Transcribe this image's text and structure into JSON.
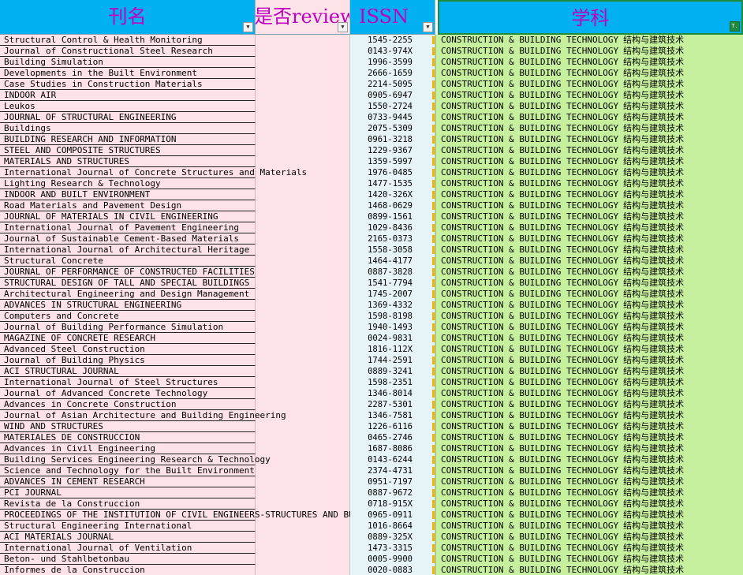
{
  "headers": {
    "journal": "刊名",
    "review": "是否review",
    "issn": "ISSN",
    "subject": "学科",
    "filter_arrow": "▼",
    "filter_active": "T."
  },
  "rows": [
    {
      "title": "Structural Control & Health Monitoring",
      "issn": "1545-2255",
      "subject_en": "CONSTRUCTION & BUILDING TECHNOLOGY",
      "subject_cn": "结构与建筑技术"
    },
    {
      "title": "Journal of Constructional Steel Research",
      "issn": "0143-974X",
      "subject_en": "CONSTRUCTION & BUILDING TECHNOLOGY",
      "subject_cn": "结构与建筑技术"
    },
    {
      "title": "Building Simulation",
      "issn": "1996-3599",
      "subject_en": "CONSTRUCTION & BUILDING TECHNOLOGY",
      "subject_cn": "结构与建筑技术"
    },
    {
      "title": "Developments in the Built Environment",
      "issn": "2666-1659",
      "subject_en": "CONSTRUCTION & BUILDING TECHNOLOGY",
      "subject_cn": "结构与建筑技术"
    },
    {
      "title": "Case Studies in Construction Materials",
      "issn": "2214-5095",
      "subject_en": "CONSTRUCTION & BUILDING TECHNOLOGY",
      "subject_cn": "结构与建筑技术"
    },
    {
      "title": "INDOOR AIR",
      "issn": "0905-6947",
      "subject_en": "CONSTRUCTION & BUILDING TECHNOLOGY",
      "subject_cn": "结构与建筑技术"
    },
    {
      "title": "Leukos",
      "issn": "1550-2724",
      "subject_en": "CONSTRUCTION & BUILDING TECHNOLOGY",
      "subject_cn": "结构与建筑技术"
    },
    {
      "title": "JOURNAL OF STRUCTURAL ENGINEERING",
      "issn": "0733-9445",
      "subject_en": "CONSTRUCTION & BUILDING TECHNOLOGY",
      "subject_cn": "结构与建筑技术"
    },
    {
      "title": "Buildings",
      "issn": "2075-5309",
      "subject_en": "CONSTRUCTION & BUILDING TECHNOLOGY",
      "subject_cn": "结构与建筑技术"
    },
    {
      "title": "BUILDING RESEARCH AND INFORMATION",
      "issn": "0961-3218",
      "subject_en": "CONSTRUCTION & BUILDING TECHNOLOGY",
      "subject_cn": "结构与建筑技术"
    },
    {
      "title": "STEEL AND COMPOSITE STRUCTURES",
      "issn": "1229-9367",
      "subject_en": "CONSTRUCTION & BUILDING TECHNOLOGY",
      "subject_cn": "结构与建筑技术"
    },
    {
      "title": "MATERIALS AND STRUCTURES",
      "issn": "1359-5997",
      "subject_en": "CONSTRUCTION & BUILDING TECHNOLOGY",
      "subject_cn": "结构与建筑技术"
    },
    {
      "title": "International Journal of Concrete Structures and Materials",
      "issn": "1976-0485",
      "subject_en": "CONSTRUCTION & BUILDING TECHNOLOGY",
      "subject_cn": "结构与建筑技术"
    },
    {
      "title": "Lighting Research & Technology",
      "issn": "1477-1535",
      "subject_en": "CONSTRUCTION & BUILDING TECHNOLOGY",
      "subject_cn": "结构与建筑技术"
    },
    {
      "title": "INDOOR AND BUILT ENVIRONMENT",
      "issn": "1420-326X",
      "subject_en": "CONSTRUCTION & BUILDING TECHNOLOGY",
      "subject_cn": "结构与建筑技术"
    },
    {
      "title": "Road Materials and Pavement Design",
      "issn": "1468-0629",
      "subject_en": "CONSTRUCTION & BUILDING TECHNOLOGY",
      "subject_cn": "结构与建筑技术"
    },
    {
      "title": "JOURNAL OF MATERIALS IN CIVIL ENGINEERING",
      "issn": "0899-1561",
      "subject_en": "CONSTRUCTION & BUILDING TECHNOLOGY",
      "subject_cn": "结构与建筑技术"
    },
    {
      "title": "International Journal of Pavement Engineering",
      "issn": "1029-8436",
      "subject_en": "CONSTRUCTION & BUILDING TECHNOLOGY",
      "subject_cn": "结构与建筑技术"
    },
    {
      "title": "Journal of Sustainable Cement-Based Materials",
      "issn": "2165-0373",
      "subject_en": "CONSTRUCTION & BUILDING TECHNOLOGY",
      "subject_cn": "结构与建筑技术"
    },
    {
      "title": "International Journal of Architectural Heritage",
      "issn": "1558-3058",
      "subject_en": "CONSTRUCTION & BUILDING TECHNOLOGY",
      "subject_cn": "结构与建筑技术"
    },
    {
      "title": "Structural Concrete",
      "issn": "1464-4177",
      "subject_en": "CONSTRUCTION & BUILDING TECHNOLOGY",
      "subject_cn": "结构与建筑技术"
    },
    {
      "title": "JOURNAL OF PERFORMANCE OF CONSTRUCTED FACILITIES",
      "issn": "0887-3828",
      "subject_en": "CONSTRUCTION & BUILDING TECHNOLOGY",
      "subject_cn": "结构与建筑技术"
    },
    {
      "title": "STRUCTURAL DESIGN OF TALL AND SPECIAL BUILDINGS",
      "issn": "1541-7794",
      "subject_en": "CONSTRUCTION & BUILDING TECHNOLOGY",
      "subject_cn": "结构与建筑技术"
    },
    {
      "title": "Architectural Engineering and Design Management",
      "issn": "1745-2007",
      "subject_en": "CONSTRUCTION & BUILDING TECHNOLOGY",
      "subject_cn": "结构与建筑技术"
    },
    {
      "title": "ADVANCES IN STRUCTURAL ENGINEERING",
      "issn": "1369-4332",
      "subject_en": "CONSTRUCTION & BUILDING TECHNOLOGY",
      "subject_cn": "结构与建筑技术"
    },
    {
      "title": "Computers and Concrete",
      "issn": "1598-8198",
      "subject_en": "CONSTRUCTION & BUILDING TECHNOLOGY",
      "subject_cn": "结构与建筑技术"
    },
    {
      "title": "Journal of Building Performance Simulation",
      "issn": "1940-1493",
      "subject_en": "CONSTRUCTION & BUILDING TECHNOLOGY",
      "subject_cn": "结构与建筑技术"
    },
    {
      "title": "MAGAZINE OF CONCRETE RESEARCH",
      "issn": "0024-9831",
      "subject_en": "CONSTRUCTION & BUILDING TECHNOLOGY",
      "subject_cn": "结构与建筑技术"
    },
    {
      "title": "Advanced Steel Construction",
      "issn": "1816-112X",
      "subject_en": "CONSTRUCTION & BUILDING TECHNOLOGY",
      "subject_cn": "结构与建筑技术"
    },
    {
      "title": "Journal of Building Physics",
      "issn": "1744-2591",
      "subject_en": "CONSTRUCTION & BUILDING TECHNOLOGY",
      "subject_cn": "结构与建筑技术"
    },
    {
      "title": "ACI STRUCTURAL JOURNAL",
      "issn": "0889-3241",
      "subject_en": "CONSTRUCTION & BUILDING TECHNOLOGY",
      "subject_cn": "结构与建筑技术"
    },
    {
      "title": "International Journal of Steel Structures",
      "issn": "1598-2351",
      "subject_en": "CONSTRUCTION & BUILDING TECHNOLOGY",
      "subject_cn": "结构与建筑技术"
    },
    {
      "title": "Journal of Advanced Concrete Technology",
      "issn": "1346-8014",
      "subject_en": "CONSTRUCTION & BUILDING TECHNOLOGY",
      "subject_cn": "结构与建筑技术"
    },
    {
      "title": "Advances in Concrete Construction",
      "issn": "2287-5301",
      "subject_en": "CONSTRUCTION & BUILDING TECHNOLOGY",
      "subject_cn": "结构与建筑技术"
    },
    {
      "title": "Journal of Asian Architecture and Building Engineering",
      "issn": "1346-7581",
      "subject_en": "CONSTRUCTION & BUILDING TECHNOLOGY",
      "subject_cn": "结构与建筑技术"
    },
    {
      "title": "WIND AND STRUCTURES",
      "issn": "1226-6116",
      "subject_en": "CONSTRUCTION & BUILDING TECHNOLOGY",
      "subject_cn": "结构与建筑技术"
    },
    {
      "title": "MATERIALES DE CONSTRUCCION",
      "issn": "0465-2746",
      "subject_en": "CONSTRUCTION & BUILDING TECHNOLOGY",
      "subject_cn": "结构与建筑技术"
    },
    {
      "title": "Advances in Civil Engineering",
      "issn": "1687-8086",
      "subject_en": "CONSTRUCTION & BUILDING TECHNOLOGY",
      "subject_cn": "结构与建筑技术"
    },
    {
      "title": "Building Services Engineering Research & Technology",
      "issn": "0143-6244",
      "subject_en": "CONSTRUCTION & BUILDING TECHNOLOGY",
      "subject_cn": "结构与建筑技术"
    },
    {
      "title": "Science and Technology for the Built Environment",
      "issn": "2374-4731",
      "subject_en": "CONSTRUCTION & BUILDING TECHNOLOGY",
      "subject_cn": "结构与建筑技术"
    },
    {
      "title": "ADVANCES IN CEMENT RESEARCH",
      "issn": "0951-7197",
      "subject_en": "CONSTRUCTION & BUILDING TECHNOLOGY",
      "subject_cn": "结构与建筑技术"
    },
    {
      "title": "PCI JOURNAL",
      "issn": "0887-9672",
      "subject_en": "CONSTRUCTION & BUILDING TECHNOLOGY",
      "subject_cn": "结构与建筑技术"
    },
    {
      "title": "Revista de la Construccion",
      "issn": "0718-915X",
      "subject_en": "CONSTRUCTION & BUILDING TECHNOLOGY",
      "subject_cn": "结构与建筑技术"
    },
    {
      "title": "PROCEEDINGS OF THE INSTITUTION OF CIVIL ENGINEERS-STRUCTURES AND BUILDINGS",
      "issn": "0965-0911",
      "subject_en": "CONSTRUCTION & BUILDING TECHNOLOGY",
      "subject_cn": "结构与建筑技术"
    },
    {
      "title": "Structural Engineering International",
      "issn": "1016-8664",
      "subject_en": "CONSTRUCTION & BUILDING TECHNOLOGY",
      "subject_cn": "结构与建筑技术"
    },
    {
      "title": "ACI MATERIALS JOURNAL",
      "issn": "0889-325X",
      "subject_en": "CONSTRUCTION & BUILDING TECHNOLOGY",
      "subject_cn": "结构与建筑技术"
    },
    {
      "title": "International Journal of Ventilation",
      "issn": "1473-3315",
      "subject_en": "CONSTRUCTION & BUILDING TECHNOLOGY",
      "subject_cn": "结构与建筑技术"
    },
    {
      "title": "Beton- und Stahlbetonbau",
      "issn": "0005-9900",
      "subject_en": "CONSTRUCTION & BUILDING TECHNOLOGY",
      "subject_cn": "结构与建筑技术"
    },
    {
      "title": "Informes de la Construccion",
      "issn": "0020-0883",
      "subject_en": "CONSTRUCTION & BUILDING TECHNOLOGY",
      "subject_cn": "结构与建筑技术"
    }
  ]
}
